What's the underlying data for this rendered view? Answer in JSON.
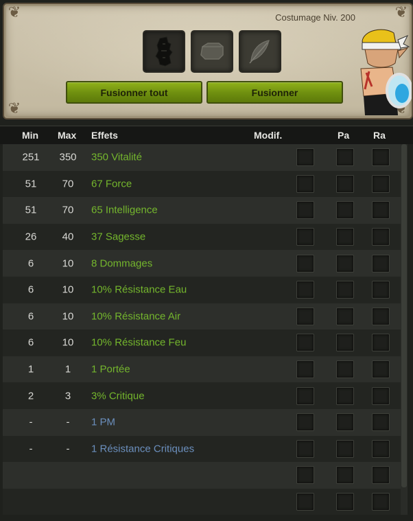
{
  "panel": {
    "item_level": "Costumage Niv. 200",
    "slots": [
      {
        "icon": "statue-rune-icon"
      },
      {
        "icon": "stone-block-icon"
      },
      {
        "icon": "feather-icon"
      }
    ],
    "merge_all_label": "Fusionner tout",
    "merge_label": "Fusionner",
    "avatar_icon": "character-avatar-icon"
  },
  "table": {
    "headers": {
      "min": "Min",
      "max": "Max",
      "effects": "Effets",
      "modif": "Modif.",
      "pa": "Pa",
      "ra": "Ra"
    },
    "rows": [
      {
        "min": "251",
        "max": "350",
        "effect": "350 Vitalité",
        "color": "green"
      },
      {
        "min": "51",
        "max": "70",
        "effect": "67 Force",
        "color": "green"
      },
      {
        "min": "51",
        "max": "70",
        "effect": "65 Intelligence",
        "color": "green"
      },
      {
        "min": "26",
        "max": "40",
        "effect": "37 Sagesse",
        "color": "green"
      },
      {
        "min": "6",
        "max": "10",
        "effect": "8 Dommages",
        "color": "green"
      },
      {
        "min": "6",
        "max": "10",
        "effect": "10% Résistance Eau",
        "color": "green"
      },
      {
        "min": "6",
        "max": "10",
        "effect": "10% Résistance Air",
        "color": "green"
      },
      {
        "min": "6",
        "max": "10",
        "effect": "10% Résistance Feu",
        "color": "green"
      },
      {
        "min": "1",
        "max": "1",
        "effect": "1 Portée",
        "color": "green"
      },
      {
        "min": "2",
        "max": "3",
        "effect": "3% Critique",
        "color": "green"
      },
      {
        "min": "-",
        "max": "-",
        "effect": "1 PM",
        "color": "blue"
      },
      {
        "min": "-",
        "max": "-",
        "effect": "1 Résistance Critiques",
        "color": "blue"
      },
      {
        "min": "",
        "max": "",
        "effect": "",
        "color": "green"
      },
      {
        "min": "",
        "max": "",
        "effect": "",
        "color": "green"
      }
    ]
  },
  "colors": {
    "positive_effect": "#74b62d",
    "exotic_effect": "#6b8fbd",
    "button_green": "#7a9c12"
  }
}
